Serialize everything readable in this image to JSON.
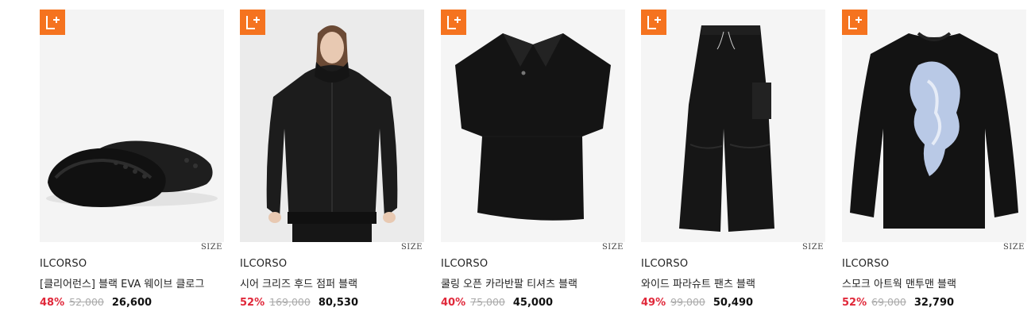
{
  "badge_color": "#f5731f",
  "discount_color": "#e0283a",
  "products": [
    {
      "image": "black-eva-clogs",
      "size_label": "SIZE",
      "brand": "ILCORSO",
      "name": "[클리어런스] 블랙 EVA 웨이브 클로그",
      "discount": "48%",
      "original_price": "52,000",
      "sale_price": "26,600"
    },
    {
      "image": "black-hooded-zip-jacket",
      "size_label": "SIZE",
      "brand": "ILCORSO",
      "name": "시어 크리즈 후드 점퍼 블랙",
      "discount": "52%",
      "original_price": "169,000",
      "sale_price": "80,530"
    },
    {
      "image": "black-open-collar-tshirt",
      "size_label": "SIZE",
      "brand": "ILCORSO",
      "name": "쿨링 오픈 카라반팔 티셔츠 블랙",
      "discount": "40%",
      "original_price": "75,000",
      "sale_price": "45,000"
    },
    {
      "image": "black-wide-parachute-pants",
      "size_label": "SIZE",
      "brand": "ILCORSO",
      "name": "와이드 파라슈트 팬츠 블랙",
      "discount": "49%",
      "original_price": "99,000",
      "sale_price": "50,490"
    },
    {
      "image": "black-smoke-artwork-sweatshirt",
      "size_label": "SIZE",
      "brand": "ILCORSO",
      "name": "스모크 아트웍 맨투맨 블랙",
      "discount": "52%",
      "original_price": "69,000",
      "sale_price": "32,790"
    }
  ]
}
